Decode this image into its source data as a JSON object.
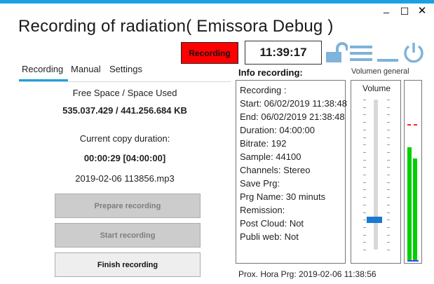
{
  "window": {
    "title": "Recording of radiation( Emissora Debug )",
    "controls": {
      "minimize": "_",
      "maximize": "☐",
      "close": "✕"
    }
  },
  "header": {
    "status_badge": "Recording",
    "clock": "11:39:17",
    "icons": [
      "unlock-icon",
      "menu-icon",
      "minimize-icon",
      "power-icon"
    ],
    "accent_color": "#1ba1e2",
    "badge_color": "#ff0000"
  },
  "tabs": [
    {
      "label": "Recording",
      "active": true
    },
    {
      "label": "Manual",
      "active": false
    },
    {
      "label": "Settings",
      "active": false
    }
  ],
  "recording_panel": {
    "space_label": "Free Space / Space Used",
    "space_value": "535.037.429 / 441.256.684 KB",
    "duration_label": "Current copy duration:",
    "duration_value": "00:00:29 [04:00:00]",
    "file_name": "2019-02-06 113856.mp3",
    "buttons": {
      "prepare": "Prepare recording",
      "start": "Start recording",
      "finish": "Finish recording"
    }
  },
  "info": {
    "title": "Info recording:",
    "lines": [
      "Recording :",
      "Start: 06/02/2019 11:38:48",
      "End: 06/02/2019 21:38:48",
      "Duration: 04:00:00",
      "Bitrate: 192",
      "Sample: 44100",
      "Channels: Stereo",
      "Save Prg:",
      "Prg Name: 30 minuts",
      "Remission:",
      "Post Cloud: Not",
      "Publi web: Not"
    ],
    "next_program": "Prox. Hora Prg: 2019-02-06 11:38:56"
  },
  "volume": {
    "general_label": "Volumen general",
    "box_label": "Volume",
    "slider_level": 0.2,
    "meter_left_level": 0.63,
    "meter_right_level": 0.57,
    "meter_peak_level": 0.76
  }
}
